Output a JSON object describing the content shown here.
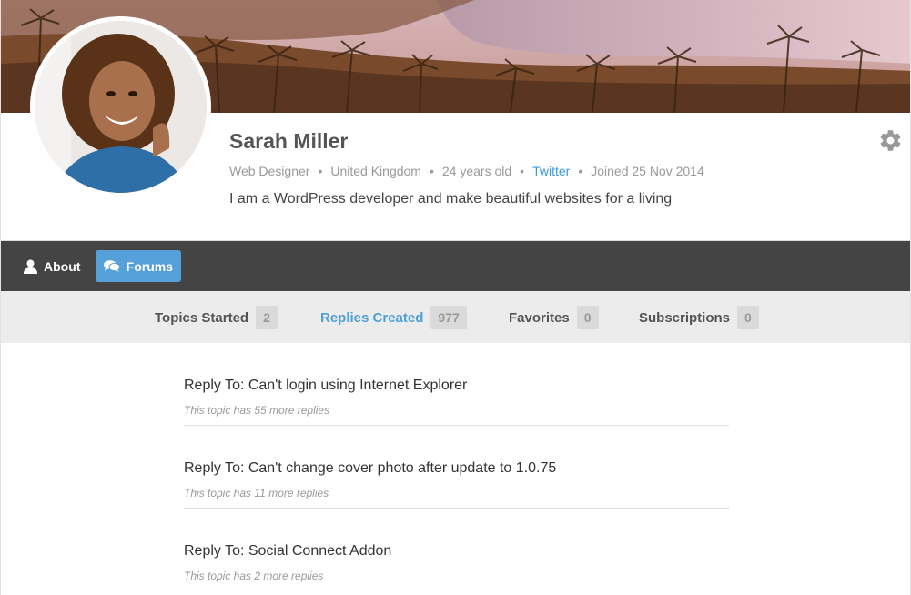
{
  "profile": {
    "name": "Sarah Miller",
    "role": "Web Designer",
    "location": "United Kingdom",
    "age": "24 years old",
    "twitter": "Twitter",
    "joined": "Joined 25 Nov 2014",
    "bio": "I am a WordPress developer and make beautiful websites for a living",
    "separator": "•"
  },
  "nav": {
    "about_label": "About",
    "forums_label": "Forums"
  },
  "subtabs": [
    {
      "label": "Topics Started",
      "count": "2"
    },
    {
      "label": "Replies Created",
      "count": "977"
    },
    {
      "label": "Favorites",
      "count": "0"
    },
    {
      "label": "Subscriptions",
      "count": "0"
    }
  ],
  "replies": [
    {
      "title": "Reply To: Can't login using Internet Explorer",
      "sub": "This topic has 55 more replies"
    },
    {
      "title": "Reply To: Can't change cover photo after update to 1.0.75",
      "sub": "This topic has 11 more replies"
    },
    {
      "title": "Reply To: Social Connect Addon",
      "sub": "This topic has 2 more replies"
    }
  ],
  "colors": {
    "accent": "#55a0d8",
    "navbar": "#444444",
    "link": "#3d9ad6"
  },
  "icons": {
    "settings": "gear-icon",
    "about": "user-icon",
    "forums": "comments-icon"
  }
}
